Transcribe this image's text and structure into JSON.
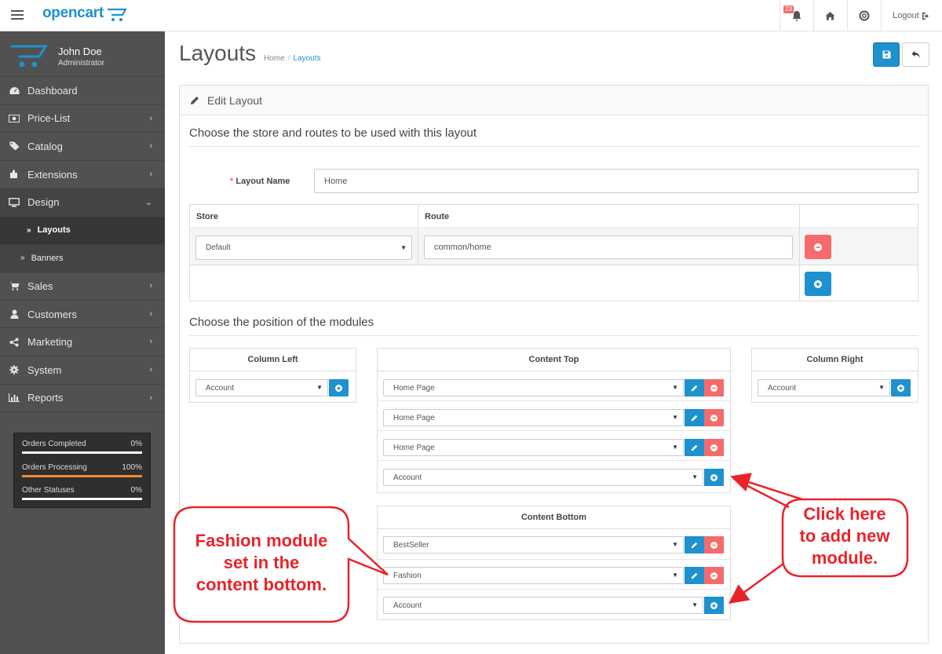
{
  "header": {
    "brand": "opencart",
    "notification_count": "23",
    "logout_label": "Logout"
  },
  "profile": {
    "name": "John Doe",
    "role": "Administrator"
  },
  "sidebar": {
    "items": [
      {
        "label": "Dashboard",
        "icon": "dashboard-icon"
      },
      {
        "label": "Price-List",
        "icon": "money-icon"
      },
      {
        "label": "Catalog",
        "icon": "tag-icon"
      },
      {
        "label": "Extensions",
        "icon": "puzzle-icon"
      },
      {
        "label": "Design",
        "icon": "desktop-icon"
      },
      {
        "label": "Layouts"
      },
      {
        "label": "Banners"
      },
      {
        "label": "Sales",
        "icon": "cart-icon"
      },
      {
        "label": "Customers",
        "icon": "user-icon"
      },
      {
        "label": "Marketing",
        "icon": "share-icon"
      },
      {
        "label": "System",
        "icon": "cog-icon"
      },
      {
        "label": "Reports",
        "icon": "bar-chart-icon"
      }
    ],
    "stats": [
      {
        "label": "Orders Completed",
        "value": "0%",
        "fill": 0,
        "color": "#ffffff"
      },
      {
        "label": "Orders Processing",
        "value": "100%",
        "fill": 1,
        "color": "#f38733"
      },
      {
        "label": "Other Statuses",
        "value": "0%",
        "fill": 0,
        "color": "#ffffff"
      }
    ]
  },
  "page": {
    "title": "Layouts",
    "breadcrumb": [
      "Home",
      "Layouts"
    ],
    "panel_title": "Edit Layout",
    "legend_store": "Choose the store and routes to be used with this layout",
    "legend_modules": "Choose the position of the modules",
    "layout_name_label": "Layout Name",
    "layout_name_value": "Home"
  },
  "route_table": {
    "headers": [
      "Store",
      "Route"
    ],
    "store_value": "Default",
    "route_value": "common/home"
  },
  "positions": {
    "column_left": {
      "title": "Column Left",
      "rows": [
        "Account"
      ]
    },
    "content_top": {
      "title": "Content Top",
      "rows": [
        "Home Page",
        "Home Page",
        "Home Page",
        "Account"
      ]
    },
    "column_right": {
      "title": "Column Right",
      "rows": [
        "Account"
      ]
    },
    "content_bottom": {
      "title": "Content Bottom",
      "rows": [
        "BestSeller",
        "Fashion",
        "Account"
      ]
    }
  },
  "annotations": {
    "left": [
      "Fashion module",
      "set in the",
      "content bottom."
    ],
    "right": [
      "Click here",
      "to add new",
      "module."
    ]
  },
  "colors": {
    "primary": "#1e91cf",
    "danger": "#f56b6b",
    "sidebar": "#515151",
    "annotation": "#e8242a"
  }
}
